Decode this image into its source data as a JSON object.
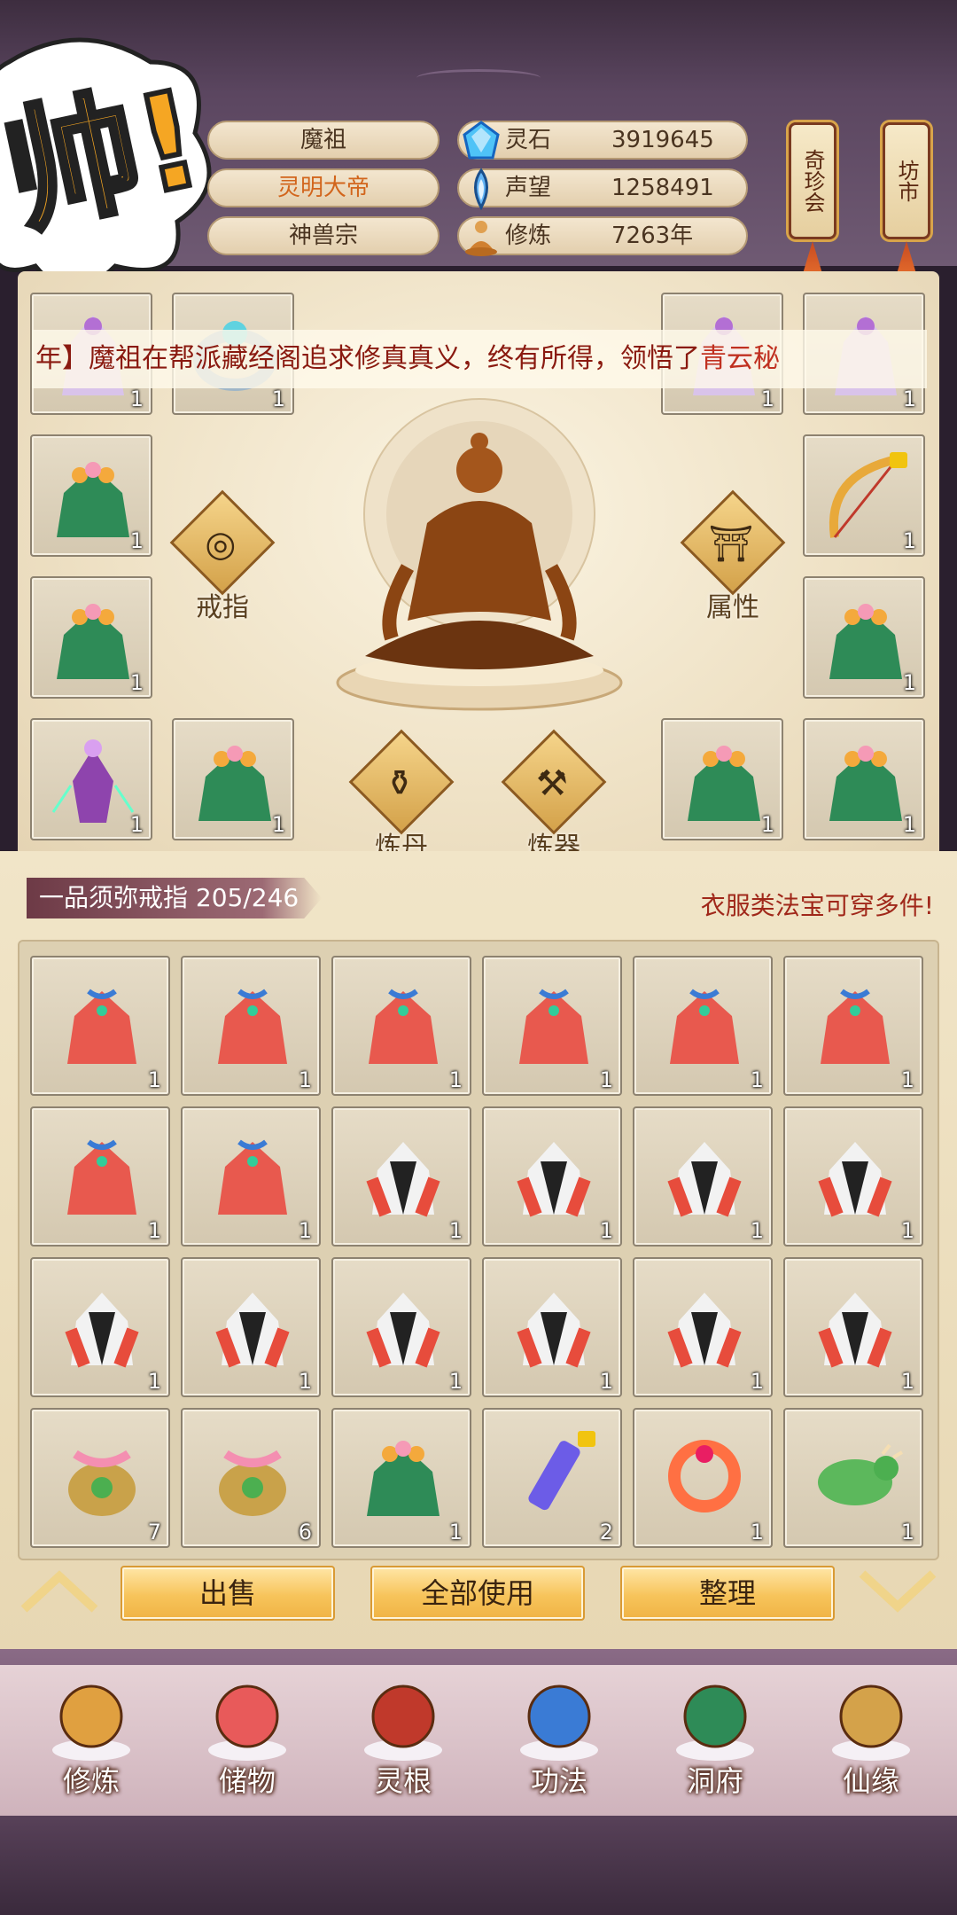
{
  "header": {
    "shout_text": "帅!",
    "rank": "魔祖",
    "title": "灵明大帝",
    "sect": "神兽宗"
  },
  "resources": [
    {
      "icon": "spirit-stone-icon",
      "label": "灵石",
      "value": "3919645"
    },
    {
      "icon": "prestige-icon",
      "label": "声望",
      "value": "1258491"
    },
    {
      "icon": "cultivation-icon",
      "label": "修炼",
      "value": "7263年"
    }
  ],
  "shops": {
    "treasure_auction": "奇珍会",
    "market": "坊市"
  },
  "ticker": {
    "prefix": "年】",
    "body": "魔祖在帮派藏经阁追求修真真义，终有所得，领悟了",
    "highlight": "青云秘"
  },
  "equipment": {
    "left_slots": [
      {
        "item": "purple-spirit-robe",
        "qty": "1"
      },
      {
        "item": "jade-ring",
        "qty": "1"
      },
      {
        "item": "lotus-green-robe",
        "qty": "1"
      },
      {
        "item": "lotus-green-robe",
        "qty": "1"
      },
      {
        "item": "purple-fairy-figure",
        "qty": "1"
      },
      {
        "item": "lotus-green-robe",
        "qty": "1"
      }
    ],
    "right_slots": [
      {
        "item": "purple-spirit-robe",
        "qty": "1"
      },
      {
        "item": "purple-spirit-robe",
        "qty": "1"
      },
      {
        "item": "golden-bow",
        "qty": "1"
      },
      {
        "item": "lotus-green-robe",
        "qty": "1"
      },
      {
        "item": "lotus-green-robe",
        "qty": "1"
      },
      {
        "item": "lotus-green-robe",
        "qty": "1"
      }
    ],
    "buttons": {
      "ring": "戒指",
      "attributes": "属性",
      "alchemy": "炼丹",
      "forging": "炼器"
    }
  },
  "bag": {
    "title": "一品须弥戒指 205/246",
    "tip": "衣服类法宝可穿多件!",
    "items": [
      {
        "item": "red-robe",
        "qty": "1"
      },
      {
        "item": "red-robe",
        "qty": "1"
      },
      {
        "item": "red-robe",
        "qty": "1"
      },
      {
        "item": "red-robe",
        "qty": "1"
      },
      {
        "item": "red-robe",
        "qty": "1"
      },
      {
        "item": "red-robe",
        "qty": "1"
      },
      {
        "item": "red-robe",
        "qty": "1"
      },
      {
        "item": "red-robe",
        "qty": "1"
      },
      {
        "item": "red-white-robe",
        "qty": "1"
      },
      {
        "item": "red-white-robe",
        "qty": "1"
      },
      {
        "item": "red-white-robe",
        "qty": "1"
      },
      {
        "item": "red-white-robe",
        "qty": "1"
      },
      {
        "item": "red-white-robe",
        "qty": "1"
      },
      {
        "item": "red-white-robe",
        "qty": "1"
      },
      {
        "item": "red-white-robe",
        "qty": "1"
      },
      {
        "item": "red-white-robe",
        "qty": "1"
      },
      {
        "item": "red-white-robe",
        "qty": "1"
      },
      {
        "item": "red-white-robe",
        "qty": "1"
      },
      {
        "item": "treasure-pouch",
        "qty": "7"
      },
      {
        "item": "treasure-pouch",
        "qty": "6"
      },
      {
        "item": "lotus-green-robe",
        "qty": "1"
      },
      {
        "item": "crystal-talisman",
        "qty": "2"
      },
      {
        "item": "flame-bracelet",
        "qty": "1"
      },
      {
        "item": "green-beast",
        "qty": "1"
      }
    ]
  },
  "actions": {
    "sell": "出售",
    "use_all": "全部使用",
    "sort": "整理"
  },
  "nav": [
    {
      "icon": "cultivate-icon",
      "label": "修炼"
    },
    {
      "icon": "storage-bag-icon",
      "label": "储物"
    },
    {
      "icon": "spirit-root-icon",
      "label": "灵根"
    },
    {
      "icon": "technique-book-icon",
      "label": "功法"
    },
    {
      "icon": "cave-dwelling-icon",
      "label": "洞府"
    },
    {
      "icon": "immortal-fate-icon",
      "label": "仙缘"
    }
  ],
  "colors": {
    "accent_orange": "#d2651c",
    "ticker_red": "#8a1a10",
    "button_gold": "#f7c45b",
    "frame_purple": "#6a4f6a"
  }
}
